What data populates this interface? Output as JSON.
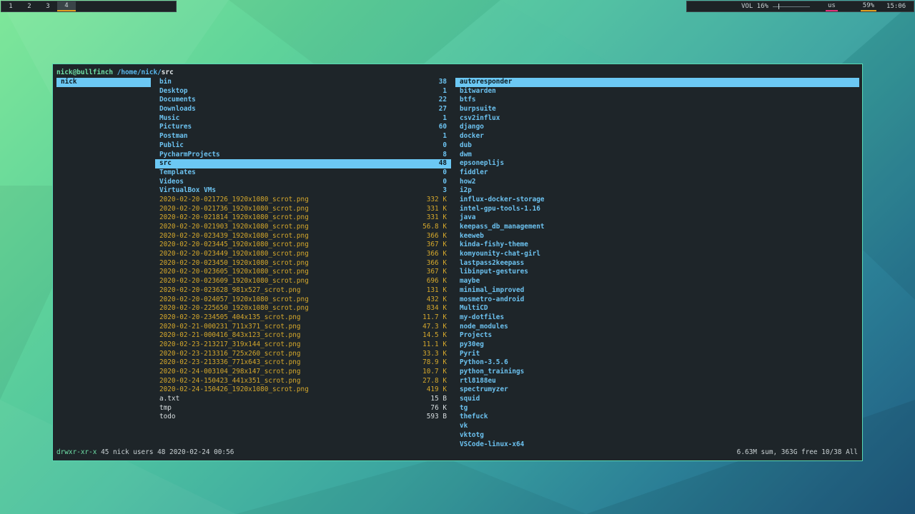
{
  "workspaces": [
    {
      "label": "1",
      "active": false
    },
    {
      "label": "2",
      "active": false
    },
    {
      "label": "3",
      "active": false
    },
    {
      "label": "4",
      "active": true
    }
  ],
  "status": {
    "volume": "VOL 16%",
    "volume_level": 0.16,
    "keyboard": "us",
    "battery": "59%",
    "clock": "15:06"
  },
  "title": {
    "user_host": "nick@bullfinch",
    "path": "/home/nick/",
    "current": "src"
  },
  "parent": [
    {
      "name": "nick",
      "selected": true
    }
  ],
  "listing": [
    {
      "name": "bin",
      "size": "38",
      "type": "dir"
    },
    {
      "name": "Desktop",
      "size": "1",
      "type": "dir"
    },
    {
      "name": "Documents",
      "size": "22",
      "type": "dir"
    },
    {
      "name": "Downloads",
      "size": "27",
      "type": "dir"
    },
    {
      "name": "Music",
      "size": "1",
      "type": "dir"
    },
    {
      "name": "Pictures",
      "size": "60",
      "type": "dir"
    },
    {
      "name": "Postman",
      "size": "1",
      "type": "dir"
    },
    {
      "name": "Public",
      "size": "0",
      "type": "dir"
    },
    {
      "name": "PycharmProjects",
      "size": "8",
      "type": "dir"
    },
    {
      "name": "src",
      "size": "48",
      "type": "dir",
      "selected": true
    },
    {
      "name": "Templates",
      "size": "0",
      "type": "dir"
    },
    {
      "name": "Videos",
      "size": "0",
      "type": "dir"
    },
    {
      "name": "VirtualBox VMs",
      "size": "3",
      "type": "dir"
    },
    {
      "name": "2020-02-20-021726_1920x1080_scrot.png",
      "size": "332 K",
      "type": "img"
    },
    {
      "name": "2020-02-20-021736_1920x1080_scrot.png",
      "size": "331 K",
      "type": "img"
    },
    {
      "name": "2020-02-20-021814_1920x1080_scrot.png",
      "size": "331 K",
      "type": "img"
    },
    {
      "name": "2020-02-20-021903_1920x1080_scrot.png",
      "size": "56.8 K",
      "type": "img"
    },
    {
      "name": "2020-02-20-023439_1920x1080_scrot.png",
      "size": "366 K",
      "type": "img"
    },
    {
      "name": "2020-02-20-023445_1920x1080_scrot.png",
      "size": "367 K",
      "type": "img"
    },
    {
      "name": "2020-02-20-023449_1920x1080_scrot.png",
      "size": "366 K",
      "type": "img"
    },
    {
      "name": "2020-02-20-023450_1920x1080_scrot.png",
      "size": "366 K",
      "type": "img"
    },
    {
      "name": "2020-02-20-023605_1920x1080_scrot.png",
      "size": "367 K",
      "type": "img"
    },
    {
      "name": "2020-02-20-023609_1920x1080_scrot.png",
      "size": "696 K",
      "type": "img"
    },
    {
      "name": "2020-02-20-023628_981x527_scrot.png",
      "size": "131 K",
      "type": "img"
    },
    {
      "name": "2020-02-20-024057_1920x1080_scrot.png",
      "size": "432 K",
      "type": "img"
    },
    {
      "name": "2020-02-20-225650_1920x1080_scrot.png",
      "size": "834 K",
      "type": "img"
    },
    {
      "name": "2020-02-20-234505_404x135_scrot.png",
      "size": "11.7 K",
      "type": "img"
    },
    {
      "name": "2020-02-21-000231_711x371_scrot.png",
      "size": "47.3 K",
      "type": "img"
    },
    {
      "name": "2020-02-21-000416_843x123_scrot.png",
      "size": "14.5 K",
      "type": "img"
    },
    {
      "name": "2020-02-23-213217_319x144_scrot.png",
      "size": "11.1 K",
      "type": "img"
    },
    {
      "name": "2020-02-23-213316_725x260_scrot.png",
      "size": "33.3 K",
      "type": "img"
    },
    {
      "name": "2020-02-23-213336_771x643_scrot.png",
      "size": "78.9 K",
      "type": "img"
    },
    {
      "name": "2020-02-24-003104_298x147_scrot.png",
      "size": "10.7 K",
      "type": "img"
    },
    {
      "name": "2020-02-24-150423_441x351_scrot.png",
      "size": "27.8 K",
      "type": "img"
    },
    {
      "name": "2020-02-24-150426_1920x1080_scrot.png",
      "size": "419 K",
      "type": "img"
    },
    {
      "name": "a.txt",
      "size": "15 B",
      "type": "file"
    },
    {
      "name": "tmp",
      "size": "76 K",
      "type": "file"
    },
    {
      "name": "todo",
      "size": "593 B",
      "type": "file"
    }
  ],
  "preview": [
    {
      "name": "autoresponder",
      "selected": true
    },
    {
      "name": "bitwarden"
    },
    {
      "name": "btfs"
    },
    {
      "name": "burpsuite"
    },
    {
      "name": "csv2influx"
    },
    {
      "name": "django"
    },
    {
      "name": "docker"
    },
    {
      "name": "dub"
    },
    {
      "name": "dwm"
    },
    {
      "name": "epsoneplijs"
    },
    {
      "name": "fiddler"
    },
    {
      "name": "how2"
    },
    {
      "name": "i2p"
    },
    {
      "name": "influx-docker-storage"
    },
    {
      "name": "intel-gpu-tools-1.16"
    },
    {
      "name": "java"
    },
    {
      "name": "keepass_db_management"
    },
    {
      "name": "keeweb"
    },
    {
      "name": "kinda-fishy-theme"
    },
    {
      "name": "komyounity-chat-girl"
    },
    {
      "name": "lastpass2keepass"
    },
    {
      "name": "libinput-gestures"
    },
    {
      "name": "maybe"
    },
    {
      "name": "minimal_improved"
    },
    {
      "name": "mosmetro-android"
    },
    {
      "name": "MultiCD"
    },
    {
      "name": "my-dotfiles"
    },
    {
      "name": "node_modules"
    },
    {
      "name": "Projects"
    },
    {
      "name": "py30eg"
    },
    {
      "name": "Pyrit"
    },
    {
      "name": "Python-3.5.6"
    },
    {
      "name": "python_trainings"
    },
    {
      "name": "rtl8188eu"
    },
    {
      "name": "spectrumyzer"
    },
    {
      "name": "squid"
    },
    {
      "name": "tg"
    },
    {
      "name": "thefuck"
    },
    {
      "name": "vk"
    },
    {
      "name": "vktotg"
    },
    {
      "name": "VSCode-linux-x64"
    }
  ],
  "footer": {
    "permissions": "drwxr-xr-x",
    "meta": "45 nick users 48 2020-02-24 00:56",
    "summary": "6.63M sum, 363G free  10/38  All"
  }
}
